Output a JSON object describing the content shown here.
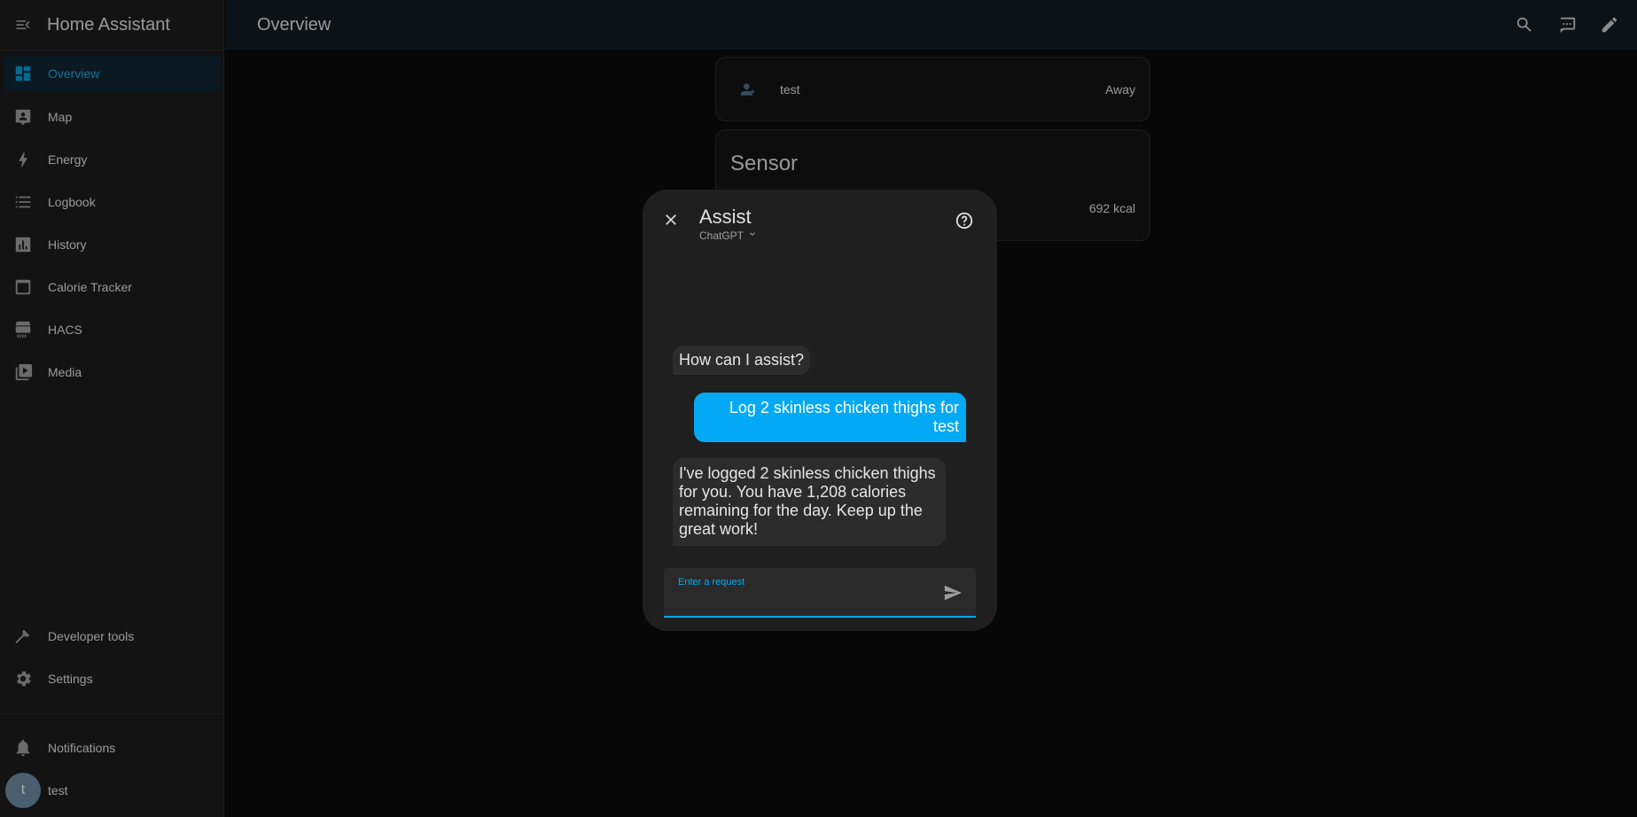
{
  "app": {
    "title": "Home Assistant"
  },
  "sidebar": {
    "items": [
      {
        "label": "Overview",
        "icon": "dashboard-icon"
      },
      {
        "label": "Map",
        "icon": "map-icon"
      },
      {
        "label": "Energy",
        "icon": "lightning-icon"
      },
      {
        "label": "Logbook",
        "icon": "list-icon"
      },
      {
        "label": "History",
        "icon": "chart-icon"
      },
      {
        "label": "Calorie Tracker",
        "icon": "box-icon"
      },
      {
        "label": "HACS",
        "icon": "hacs-icon"
      },
      {
        "label": "Media",
        "icon": "media-icon"
      }
    ],
    "bottom": [
      {
        "label": "Developer tools",
        "icon": "hammer-icon"
      },
      {
        "label": "Settings",
        "icon": "gear-icon"
      }
    ],
    "notifications_label": "Notifications",
    "user": {
      "initial": "t",
      "name": "test"
    }
  },
  "topbar": {
    "title": "Overview"
  },
  "cards": {
    "person": {
      "name": "test",
      "state": "Away"
    },
    "sensor": {
      "title": "Sensor",
      "value": "692 kcal"
    }
  },
  "dialog": {
    "title": "Assist",
    "agent": "ChatGPT",
    "messages": [
      {
        "from": "hass",
        "text": "How can I assist?"
      },
      {
        "from": "user",
        "text": "Log 2 skinless chicken thighs for test"
      },
      {
        "from": "hass",
        "text": "I've logged 2 skinless chicken thighs for you. You have 1,208 calories remaining for the day. Keep up the great work!"
      }
    ],
    "input": {
      "label": "Enter a request",
      "value": ""
    }
  },
  "colors": {
    "accent": "#03a9f4",
    "sidebar_active_bg": "#0f2533",
    "background": "#0b0b0b"
  }
}
